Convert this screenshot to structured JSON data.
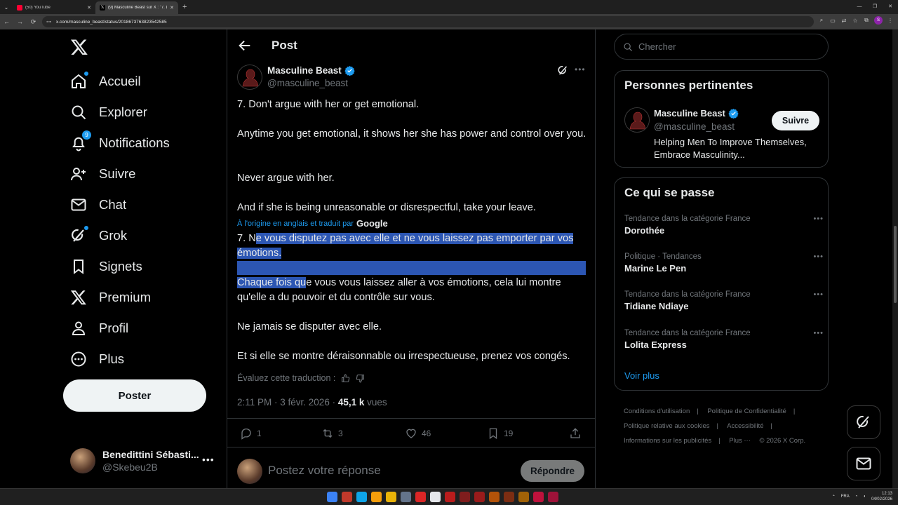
{
  "browser": {
    "tabs": [
      {
        "title": "(50) YouTube",
        "active": false
      },
      {
        "title": "(9) Masculine Beast sur X : \"7. D",
        "active": true
      }
    ],
    "url": "x.com/masculine_beast/status/2018673763823542585"
  },
  "sidebar": {
    "items": [
      {
        "label": "Accueil",
        "icon": "home-icon"
      },
      {
        "label": "Explorer",
        "icon": "search-icon"
      },
      {
        "label": "Notifications",
        "icon": "bell-icon",
        "badge": "9"
      },
      {
        "label": "Suivre",
        "icon": "person-add-icon"
      },
      {
        "label": "Chat",
        "icon": "mail-icon"
      },
      {
        "label": "Grok",
        "icon": "grok-icon"
      },
      {
        "label": "Signets",
        "icon": "bookmark-icon"
      },
      {
        "label": "Premium",
        "icon": "x-icon"
      },
      {
        "label": "Profil",
        "icon": "person-icon"
      },
      {
        "label": "Plus",
        "icon": "more-circle-icon"
      }
    ],
    "post_button": "Poster",
    "account": {
      "name": "Benedittini Sébasti...",
      "handle": "@Skebeu2B"
    }
  },
  "main": {
    "title": "Post",
    "author": {
      "name": "Masculine Beast",
      "handle": "@masculine_beast"
    },
    "original": [
      "7. Don't argue with her or get emotional.",
      "Anytime you get emotional, it shows her she has power and control over you.",
      "Never argue with her.",
      "And if she is being unreasonable or disrespectful, take your leave."
    ],
    "translated_from": "À l'origine en anglais et traduit par",
    "translator": "Google",
    "translated": {
      "p1_pre": "7. N",
      "p1_hl": "e vous disputez pas avec elle et ne vous laissez pas emporter par vos émotions.",
      "p2_hl": "Chaque fois qu",
      "p2_rest": "e vous vous laissez aller à vos émotions, cela lui montre qu'elle a du pouvoir et du contrôle sur vous.",
      "p3": "Ne jamais se disputer avec elle.",
      "p4": "Et si elle se montre déraisonnable ou irrespectueuse, prenez vos congés."
    },
    "rate_translation": "Évaluez cette traduction :",
    "time": "2:11 PM · 3 févr. 2026 ·",
    "views": "45,1 k",
    "views_label": "vues",
    "stats": {
      "replies": "1",
      "reposts": "3",
      "likes": "46",
      "bookmarks": "19"
    },
    "reply_placeholder": "Postez votre réponse",
    "reply_button": "Répondre"
  },
  "right": {
    "search_placeholder": "Chercher",
    "relevant_title": "Personnes pertinentes",
    "relevant": {
      "name": "Masculine Beast",
      "handle": "@masculine_beast",
      "bio": "Helping Men To Improve Themselves, Embrace Masculinity...",
      "follow": "Suivre"
    },
    "trends_title": "Ce qui se passe",
    "trends": [
      {
        "category": "Tendance dans la catégorie France",
        "name": "Dorothée"
      },
      {
        "category": "Politique · Tendances",
        "name": "Marine Le Pen"
      },
      {
        "category": "Tendance dans la catégorie France",
        "name": "Tidiane Ndiaye"
      },
      {
        "category": "Tendance dans la catégorie France",
        "name": "Lolita Express"
      }
    ],
    "see_more": "Voir plus",
    "footer": [
      "Conditions d'utilisation",
      "Politique de Confidentialité",
      "Politique relative aux cookies",
      "Accessibilité",
      "Informations sur les publicités",
      "Plus ···",
      "© 2026 X Corp."
    ]
  },
  "taskbar": {
    "lang": "FRA",
    "time": "12:13",
    "date": "04/02/2026"
  },
  "colors": {
    "accent": "#1d9bf0",
    "selection": "#2c56b3",
    "background": "#000000",
    "border": "#2f3336"
  }
}
